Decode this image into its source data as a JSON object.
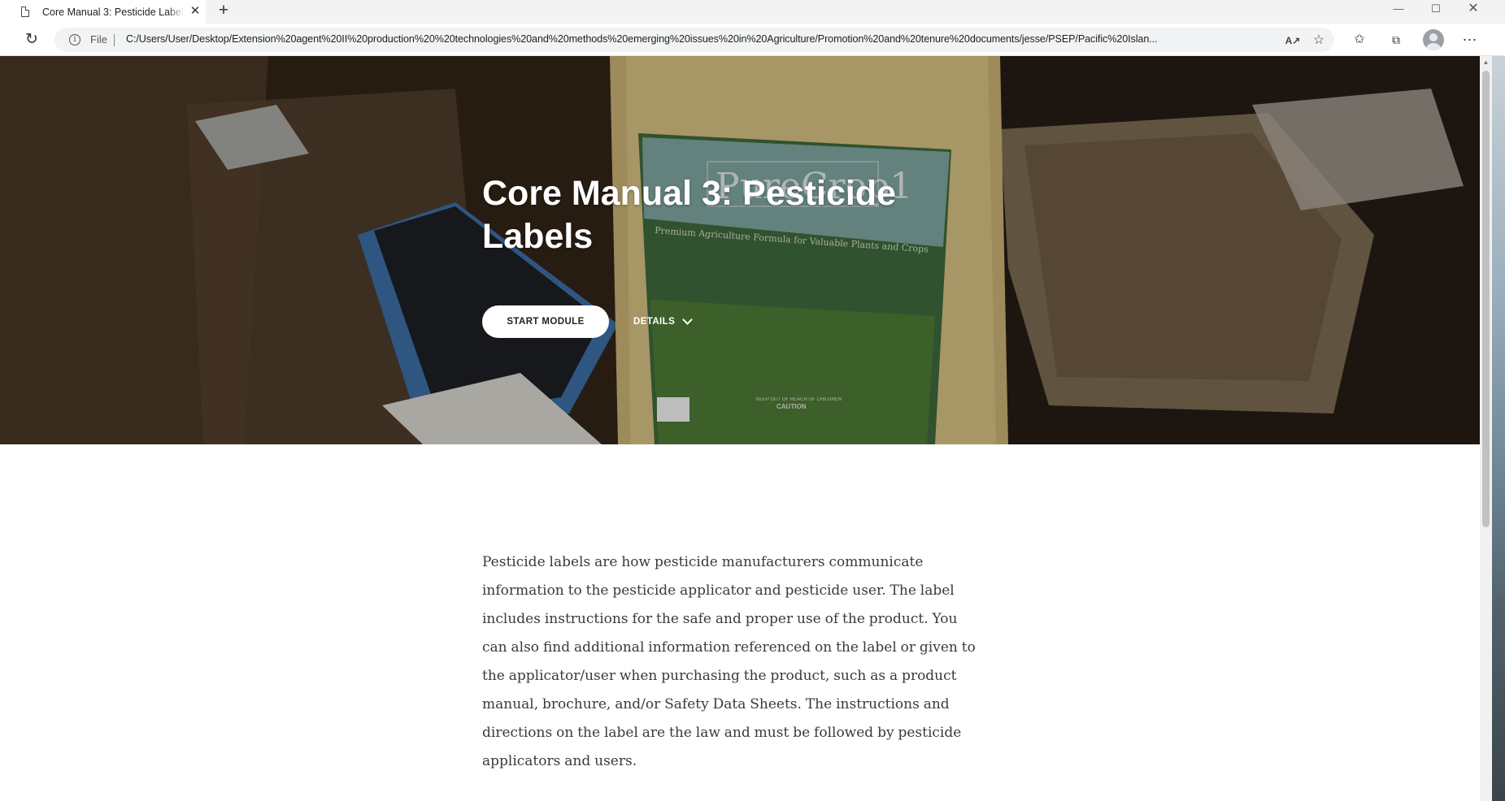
{
  "browser": {
    "tab_title": "Core Manual 3: Pesticide Labels",
    "tab_close_glyph": "✕",
    "new_tab_glyph": "+",
    "address_scheme": "File",
    "address_url": "C:/Users/User/Desktop/Extension%20agent%20II%20production%20%20technologies%20and%20methods%20emerging%20issues%20in%20Agriculture/Promotion%20and%20tenure%20documents/jesse/PSEP/Pacific%20Islan...",
    "icons": {
      "reload": "reload-icon",
      "info": "info-icon",
      "read_aloud": "read-aloud-icon",
      "add_favorite": "add-favorite-icon",
      "favorites": "favorites-icon",
      "collections": "collections-icon",
      "profile": "profile-icon",
      "menu": "more-menu-icon"
    }
  },
  "hero": {
    "title": "Core Manual 3: Pesticide Labels",
    "start_button": "START MODULE",
    "details_button": "DETAILS",
    "photo_label_brand": "PureCrop1",
    "photo_label_tagline": "Premium Agriculture Formula for Valuable Plants and Crops",
    "photo_label_caution": "KEEP OUT OF REACH OF CHILDREN",
    "photo_label_warning": "CAUTION"
  },
  "intro": {
    "text": "Pesticide labels are how pesticide manufacturers communicate information to the pesticide applicator and pesticide user. The label includes instructions for the safe and proper use of the product.  You can also find additional information referenced on the label or given to the applicator/user when purchasing the product, such as a product manual, brochure, and/or Safety Data Sheets. The instructions and directions on the label are the law and must be followed by pesticide applicators and users."
  },
  "colors": {
    "page_bg": "#ffffff",
    "hero_text": "#ffffff",
    "body_text": "#3a3a3a",
    "button_bg": "#ffffff"
  }
}
